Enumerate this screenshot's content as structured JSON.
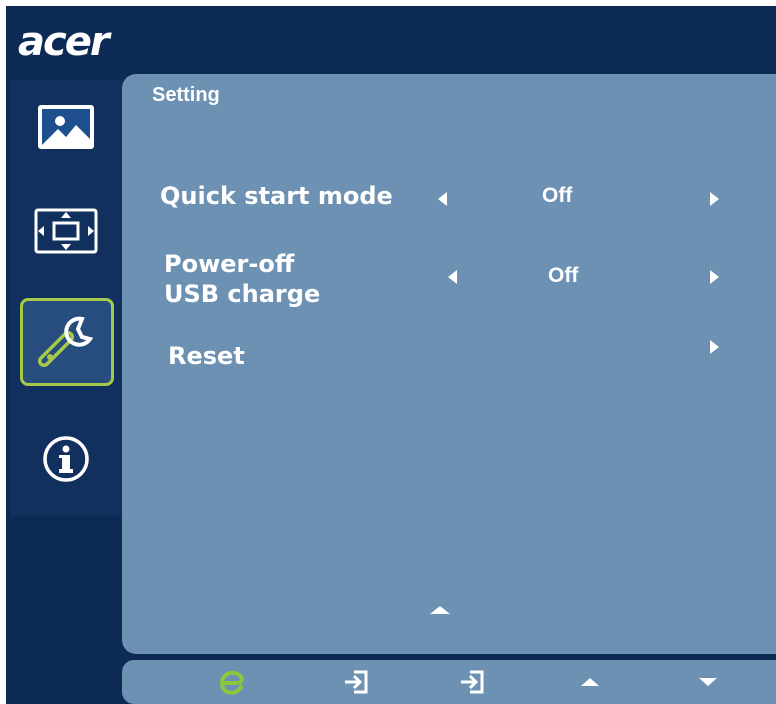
{
  "brand": {
    "logo_text": "acer"
  },
  "sidebar": {
    "items": [
      {
        "icon": "picture-icon",
        "selected": false
      },
      {
        "icon": "screen-position-icon",
        "selected": false
      },
      {
        "icon": "setting-wrench-icon",
        "selected": true
      },
      {
        "icon": "info-icon",
        "selected": false
      }
    ]
  },
  "panel": {
    "title": "Setting",
    "rows": [
      {
        "label": "Quick start mode",
        "value": "Off"
      },
      {
        "label_line1": "Power-off",
        "label_line2": "USB charge",
        "value": "Off"
      },
      {
        "label": "Reset"
      }
    ]
  },
  "keys": [
    {
      "icon": "e-mode-icon"
    },
    {
      "icon": "input-enter-icon"
    },
    {
      "icon": "input-source-icon"
    },
    {
      "icon": "up-arrow-icon"
    },
    {
      "icon": "down-arrow-icon"
    }
  ],
  "colors": {
    "background": "#0d2a55",
    "panel": "#6d91b2",
    "selected_border": "#a7c94a",
    "e_icon": "#8dc63f"
  }
}
